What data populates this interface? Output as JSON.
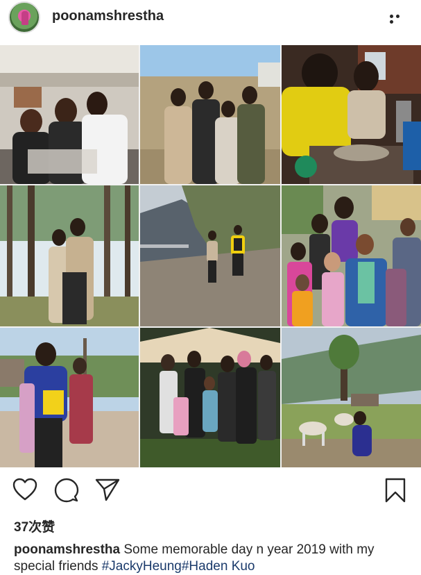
{
  "post": {
    "username": "poonamshrestha",
    "likes_text": "37次赞",
    "caption": {
      "user": "poonamshrestha",
      "text": "Some memorable day n year 2019 with my special friends",
      "tags": [
        "#JackyHeung",
        "#Haden Kuo"
      ]
    }
  },
  "icons": {
    "more": "more-options-icon",
    "like": "heart-icon",
    "comment": "comment-icon",
    "share": "send-icon",
    "save": "bookmark-icon"
  },
  "photos": [
    {
      "id": "airport-group"
    },
    {
      "id": "hill-group-four"
    },
    {
      "id": "kitchen-meal"
    },
    {
      "id": "forest-pines"
    },
    {
      "id": "mountain-road-walk"
    },
    {
      "id": "village-children"
    },
    {
      "id": "village-path-selfie"
    },
    {
      "id": "tent-group"
    },
    {
      "id": "hillside-goats"
    }
  ]
}
